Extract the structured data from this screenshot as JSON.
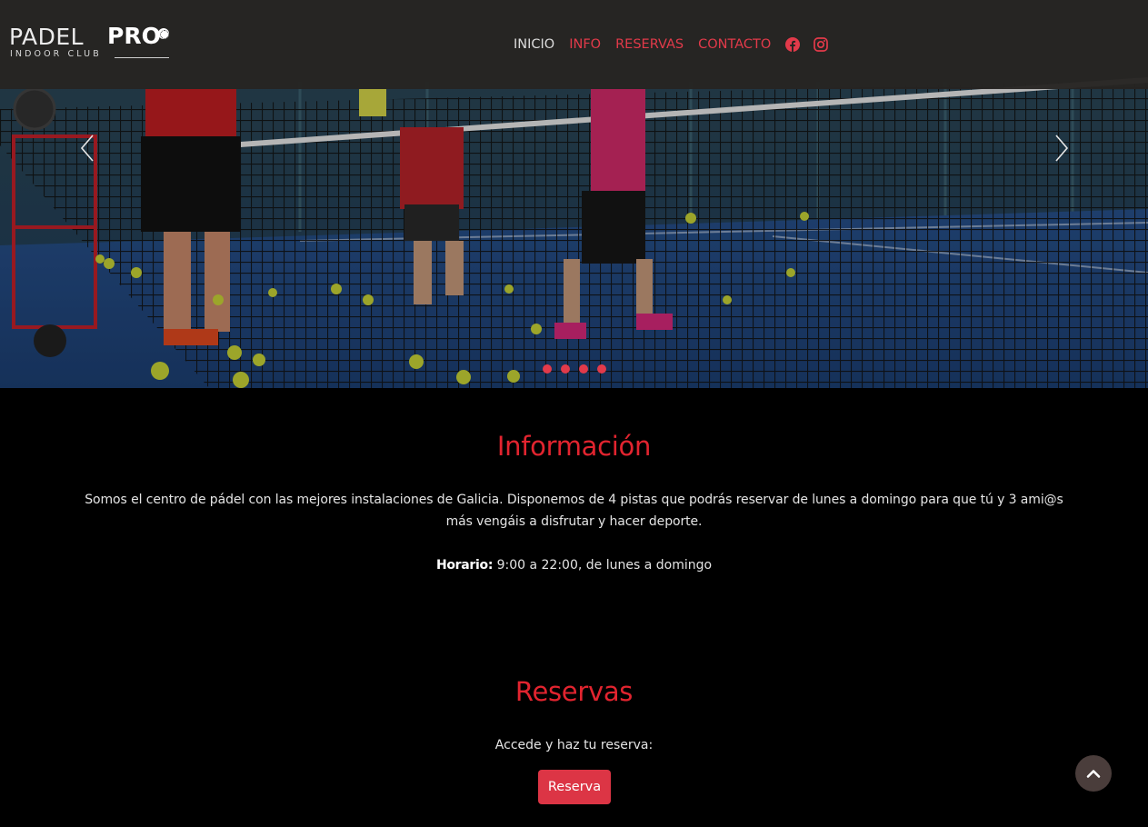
{
  "brand": {
    "name": "PADEL",
    "highlight": "PRO",
    "tagline": "INDOOR CLUB"
  },
  "nav": {
    "items": [
      {
        "label": "INICIO",
        "active": true
      },
      {
        "label": "INFO",
        "active": false
      },
      {
        "label": "RESERVAS",
        "active": false
      },
      {
        "label": "CONTACTO",
        "active": false
      }
    ],
    "social_icons": [
      "facebook-icon",
      "instagram-icon"
    ]
  },
  "carousel": {
    "slide_count": 4,
    "controls": [
      "chevron-left-icon",
      "chevron-right-icon"
    ]
  },
  "info": {
    "title": "Información",
    "text": "Somos el centro de pádel con las mejores instalaciones de Galicia. Disponemos de 4 pistas que podrás reservar de lunes a domingo para que tú y 3 ami@s más vengáis a disfrutar y hacer deporte.",
    "schedule_label": "Horario:",
    "schedule_value": " 9:00 a 22:00, de lunes a domingo"
  },
  "reservas": {
    "title": "Reservas",
    "prompt": "Accede y haz tu reserva:",
    "button_label": "Reserva"
  },
  "colors": {
    "accent": "#e2242f",
    "button": "#dc3545",
    "navbar": "#262422",
    "background": "#000000",
    "scroll_top": "#4a3d3b"
  },
  "scroll_top_icon": "chevron-up-icon"
}
